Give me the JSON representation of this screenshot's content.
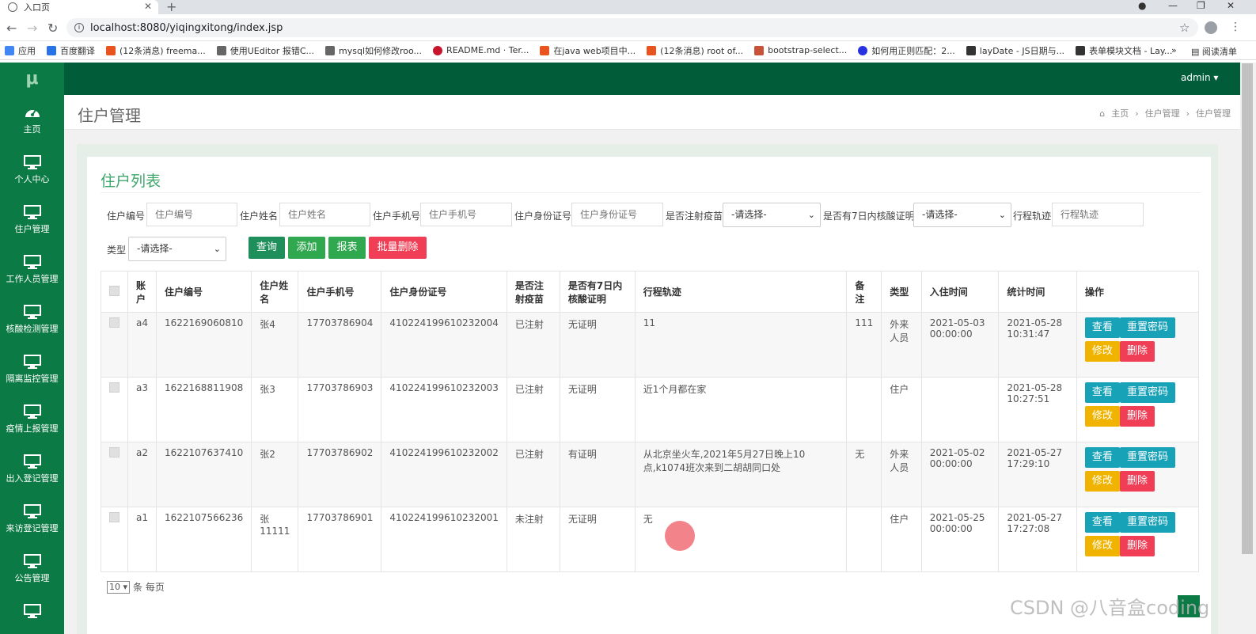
{
  "browser": {
    "tab_title": "入口页",
    "url": "localhost:8080/yiqingxitong/index.jsp",
    "bookmarks": [
      "应用",
      "百度翻译",
      "(12条消息) freema...",
      "使用UEditor 报错C...",
      "mysql如何修改roo...",
      "README.md · Ter...",
      "在java web项目中...",
      "(12条消息) root of...",
      "bootstrap-select...",
      "如何用正则匹配：2...",
      "layDate - JS日期与...",
      "表单模块文档 - Lay..."
    ],
    "bookmarks_more": "»",
    "reading_list": "阅读清单"
  },
  "app": {
    "logo": "μ",
    "user": "admin ▾",
    "sidebar": [
      "主页",
      "个人中心",
      "住户管理",
      "工作人员管理",
      "核酸检测管理",
      "隔离监控管理",
      "疫情上报管理",
      "出入登记管理",
      "来访登记管理",
      "公告管理"
    ],
    "page_title": "住户管理",
    "breadcrumb": [
      "主页",
      "住户管理",
      "住户管理"
    ]
  },
  "panel": {
    "title": "住户列表",
    "filters": {
      "code_label": "住户编号",
      "code_ph": "住户编号",
      "name_label": "住户姓名",
      "name_ph": "住户姓名",
      "phone_label": "住户手机号",
      "phone_ph": "住户手机号",
      "id_label": "住户身份证号",
      "id_ph": "住户身份证号",
      "vaccine_label": "是否注射疫苗",
      "vaccine_value": "-请选择-",
      "test_label": "是否有7日内核酸证明",
      "test_value": "-请选择-",
      "track_label": "行程轨迹",
      "track_ph": "行程轨迹",
      "type_label": "类型",
      "type_value": "-请选择-"
    },
    "buttons": {
      "query": "查询",
      "add": "添加",
      "report": "报表",
      "batch_delete": "批量删除"
    },
    "columns": [
      "账户",
      "住户编号",
      "住户姓名",
      "住户手机号",
      "住户身份证号",
      "是否注射疫苗",
      "是否有7日内核酸证明",
      "行程轨迹",
      "备注",
      "类型",
      "入住时间",
      "统计时间",
      "操作"
    ],
    "rows": [
      {
        "account": "a4",
        "code": "1622169060810",
        "name": "张4",
        "phone": "17703786904",
        "idno": "410224199610232004",
        "vaccine": "已注射",
        "test": "无证明",
        "track": "11",
        "remark": "111",
        "type": "外来人员",
        "checkin": "2021-05-03 00:00:00",
        "stat": "2021-05-28 10:31:47"
      },
      {
        "account": "a3",
        "code": "1622168811908",
        "name": "张3",
        "phone": "17703786903",
        "idno": "410224199610232003",
        "vaccine": "已注射",
        "test": "无证明",
        "track": "近1个月都在家",
        "remark": "",
        "type": "住户",
        "checkin": "",
        "stat": "2021-05-28 10:27:51"
      },
      {
        "account": "a2",
        "code": "1622107637410",
        "name": "张2",
        "phone": "17703786902",
        "idno": "410224199610232002",
        "vaccine": "已注射",
        "test": "有证明",
        "track": "从北京坐火车,2021年5月27日晚上10点,k1074班次来到二胡胡同口处",
        "remark": "无",
        "type": "外来人员",
        "checkin": "2021-05-02 00:00:00",
        "stat": "2021-05-27 17:29:10"
      },
      {
        "account": "a1",
        "code": "1622107566236",
        "name": "张11111",
        "phone": "17703786901",
        "idno": "410224199610232001",
        "vaccine": "未注射",
        "test": "无证明",
        "track": "无",
        "remark": "",
        "type": "住户",
        "checkin": "2021-05-25 00:00:00",
        "stat": "2021-05-27 17:27:08"
      }
    ],
    "row_actions": {
      "view": "查看",
      "reset": "重置密码",
      "edit": "修改",
      "delete": "删除"
    },
    "pager": {
      "size": "10",
      "suffix": "条 每页"
    }
  },
  "watermark": "CSDN @八音盒coding",
  "colors": {
    "header": "#015c3a",
    "sidebar": "#0c7a45",
    "title_green": "#3ea66b",
    "query": "#1e8f5a",
    "add": "#2fa84f",
    "report": "#2fa84f",
    "batch_delete": "#ef3e55",
    "view": "#17a2b8",
    "edit": "#f0b400",
    "delete": "#ef3e55"
  }
}
